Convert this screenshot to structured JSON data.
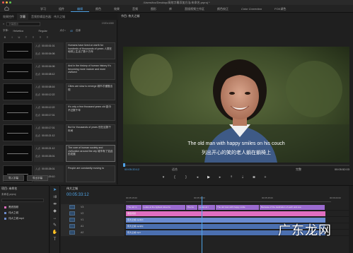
{
  "titlebar": {
    "path": "/Users/fox/Desktop/高效字幕添加方法/未命名.prproj *"
  },
  "menubar": {
    "items": [
      {
        "label": "学习",
        "active": false,
        "italic": false
      },
      {
        "label": "组件",
        "active": false,
        "italic": false
      },
      {
        "label": "编辑",
        "active": true,
        "italic": false
      },
      {
        "label": "颜色",
        "active": false,
        "italic": false
      },
      {
        "label": "效果",
        "active": false,
        "italic": false
      },
      {
        "label": "音频",
        "active": false,
        "italic": false
      },
      {
        "label": "图形",
        "active": false,
        "italic": false
      },
      {
        "label": "库",
        "active": false,
        "italic": false
      },
      {
        "label": "直接视频工作区",
        "active": false,
        "italic": false
      },
      {
        "label": "颜色校正",
        "active": false,
        "italic": false
      },
      {
        "label": "Color Correction",
        "active": false,
        "italic": true
      },
      {
        "label": "FOX调色",
        "active": false,
        "italic": false
      }
    ]
  },
  "left_panel": {
    "tabs": [
      {
        "label": "效果控件",
        "active": false
      },
      {
        "label": "字幕",
        "active": true
      },
      {
        "label": "音频剪辑混合器：伟大之城",
        "active": false
      }
    ],
    "search_placeholder": "字幕展示",
    "resolution": "1920x1080",
    "font_label": "字体：",
    "font_value": "Helvetica",
    "style_value": "Regular",
    "size_label": "大小：",
    "size_value": "40",
    "edge_label": "边缘",
    "format_buttons": [
      "B",
      "I",
      "U",
      "T",
      "≡",
      "≡",
      "≡"
    ],
    "in_label": "入点",
    "out_label": "出点",
    "captions": [
      {
        "in": "00:00:01:01",
        "out": "00:00:04:06",
        "text": "Humans have lived on earth for hundreds of thousands of years 人类在地球上生活了数十万年",
        "selected": false
      },
      {
        "in": "00:00:04:06",
        "out": "00:00:08:12",
        "text": "And in the history of human history It's becoming more mature and more civilized",
        "selected": false
      },
      {
        "in": "00:00:08:16",
        "out": "00:00:12:22",
        "text": "Cities are slow to emerge 城市才缓慢出现",
        "selected": false
      },
      {
        "in": "00:00:12:22",
        "out": "00:00:17:01",
        "text": "It's only a few thousand years old 距今不过数千年",
        "selected": false
      },
      {
        "in": "00:00:17:01",
        "out": "00:00:21:12",
        "text": "But for thousands of years 但在这数千年间",
        "selected": false
      },
      {
        "in": "00:00:21:12",
        "out": "00:00:26:01",
        "text": "The core of human society and civilization around the city 城市有了如此的发展",
        "selected": true
      },
      {
        "in": "00:00:26:01",
        "out": "00:00:29:10",
        "text": "People are constantly moving to",
        "selected": false
      }
    ],
    "import_label": "导入字幕",
    "export_label": "导出字幕"
  },
  "monitor": {
    "tab": "节目: 伟大之城",
    "subtitle_en": "The old man with happy smiles on his couch",
    "subtitle_zh": "列出开心的笑的老人躺在躺椅上",
    "timecode": "00:05:33:12",
    "fit": "适合",
    "quality": "完整",
    "duration": "00:05:52:03",
    "controls": [
      "marker",
      "in",
      "out",
      "step-back",
      "play",
      "step-forward",
      "lift",
      "extract",
      "export-frame",
      "settings"
    ]
  },
  "project": {
    "tab": "项目: 未命名",
    "subtitle": "未命名.prproj",
    "items": [
      {
        "name": "黑底视频",
        "color": "#e06ec0"
      },
      {
        "name": "伟大之城",
        "color": "#6b8ac9"
      },
      {
        "name": "伟大之城.mp4",
        "color": "#6b8ac9"
      }
    ]
  },
  "tools": [
    "selection",
    "track-select",
    "ripple",
    "razor",
    "slip",
    "pen",
    "hand",
    "type"
  ],
  "timeline": {
    "tab": "伟大之城",
    "timecode": "00:05:33:12",
    "ruler": [
      "00:05:15:00",
      "00:05:30:00",
      "00:05:45:00",
      "00:06:00:00"
    ],
    "tracks": [
      {
        "name": "V3",
        "type": "caption",
        "clips": [
          {
            "label": "The old m",
            "left_pct": 0,
            "width_pct": 8
          },
          {
            "label": "Looks at the lightest street la",
            "width_pct": 22
          },
          {
            "label": "The ho",
            "width_pct": 6
          },
          {
            "label": "Looks at t",
            "width_pct": 9
          },
          {
            "label": "The old man with happy smile",
            "width_pct": 22
          },
          {
            "label": "Because of the dedication of each and eve",
            "width_pct": 33
          }
        ]
      },
      {
        "name": "V2",
        "type": "pink",
        "label": "黑底视频"
      },
      {
        "name": "V1",
        "type": "video",
        "label": "伟大之城.mp4[V]"
      },
      {
        "name": "A1",
        "type": "audio",
        "label": "伟大之城.mp4[A]"
      },
      {
        "name": "A2",
        "type": "audio2",
        "label": "伟大之城.mp4"
      }
    ]
  },
  "watermark": "广东龙网",
  "colors": {
    "accent": "#4fa3e6",
    "caption_clip": "#9b6bd0",
    "pink_clip": "#e06ec0",
    "video_clip": "#6a8bd0",
    "audio_clip": "#4b6fb0"
  }
}
